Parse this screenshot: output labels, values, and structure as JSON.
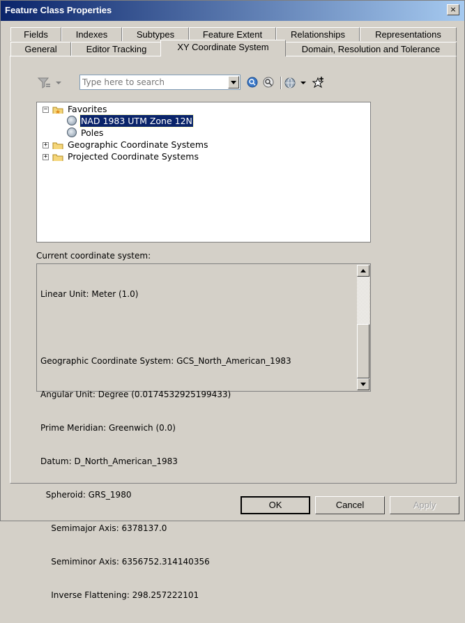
{
  "window": {
    "title": "Feature Class Properties",
    "close_glyph": "×"
  },
  "tabs_row1": [
    {
      "label": "Fields"
    },
    {
      "label": "Indexes"
    },
    {
      "label": "Subtypes"
    },
    {
      "label": "Feature Extent"
    },
    {
      "label": "Relationships"
    },
    {
      "label": "Representations"
    }
  ],
  "tabs_row2": [
    {
      "label": "General"
    },
    {
      "label": "Editor Tracking"
    },
    {
      "label": "XY Coordinate System"
    },
    {
      "label": "Domain, Resolution and Tolerance"
    }
  ],
  "active_tab": "XY Coordinate System",
  "search": {
    "placeholder": "Type here to search",
    "value": ""
  },
  "tree": {
    "favorites": {
      "label": "Favorites",
      "expanded": true,
      "children": [
        {
          "label": "NAD 1983 UTM Zone 12N",
          "selected": true
        },
        {
          "label": "Poles",
          "selected": false
        }
      ]
    },
    "geographic": {
      "label": "Geographic Coordinate Systems",
      "expanded": false
    },
    "projected": {
      "label": "Projected Coordinate Systems",
      "expanded": false
    },
    "expand_glyph": "+",
    "collapse_glyph": "−"
  },
  "current": {
    "label": "Current coordinate system:",
    "lines": [
      "Linear Unit: Meter (1.0)",
      "",
      "Geographic Coordinate System: GCS_North_American_1983",
      "Angular Unit: Degree (0.0174532925199433)",
      "Prime Meridian: Greenwich (0.0)",
      "Datum: D_North_American_1983",
      "  Spheroid: GRS_1980",
      "    Semimajor Axis: 6378137.0",
      "    Semiminor Axis: 6356752.314140356",
      "    Inverse Flattening: 298.257222101"
    ]
  },
  "buttons": {
    "ok": "OK",
    "cancel": "Cancel",
    "apply": "Apply"
  },
  "colors": {
    "titlebar_start": "#0a246a",
    "titlebar_end": "#a6caf0",
    "selection": "#0a246a",
    "face": "#d4d0c8"
  },
  "icons": [
    "filter-icon",
    "dropdown-arrow-icon",
    "search-icon",
    "clear-search-icon",
    "globe-icon",
    "add-favorite-icon",
    "folder-icon",
    "coordinate-system-icon"
  ]
}
